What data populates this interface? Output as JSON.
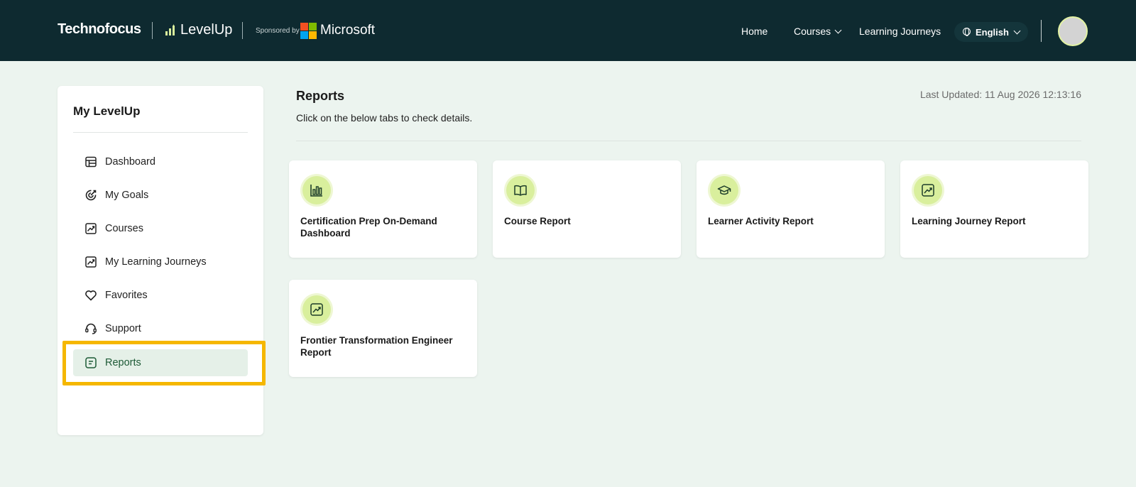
{
  "header": {
    "brand": "Technofocus",
    "product": "LevelUp",
    "sponsored_by": "Sponsored by",
    "sponsor": "Microsoft",
    "nav": {
      "home": "Home",
      "courses": "Courses",
      "learning_journeys": "Learning Journeys"
    },
    "language": "English",
    "colors": {
      "bar": "#0e2a30",
      "accent": "#d9ef9d"
    }
  },
  "sidebar": {
    "title": "My LevelUp",
    "items": [
      {
        "label": "Dashboard",
        "icon": "table-icon"
      },
      {
        "label": "My Goals",
        "icon": "target-icon"
      },
      {
        "label": "Courses",
        "icon": "chart-image-icon"
      },
      {
        "label": "My Learning Journeys",
        "icon": "chart-image-icon"
      },
      {
        "label": "Favorites",
        "icon": "heart-icon"
      },
      {
        "label": "Support",
        "icon": "headset-icon"
      },
      {
        "label": "Reports",
        "icon": "report-icon",
        "active": true
      }
    ]
  },
  "main": {
    "title": "Reports",
    "subtitle": "Click on the below tabs to check details.",
    "last_updated": "Last Updated: 11 Aug 2026 12:13:16",
    "cards": [
      {
        "title": "Certification Prep On-Demand Dashboard",
        "icon": "bar-chart-icon"
      },
      {
        "title": "Course Report",
        "icon": "book-icon"
      },
      {
        "title": "Learner Activity Report",
        "icon": "graduation-cap-icon"
      },
      {
        "title": "Learning Journey Report",
        "icon": "trend-chart-icon"
      },
      {
        "title": "Frontier Transformation Engineer Report",
        "icon": "trend-chart-icon"
      }
    ]
  }
}
